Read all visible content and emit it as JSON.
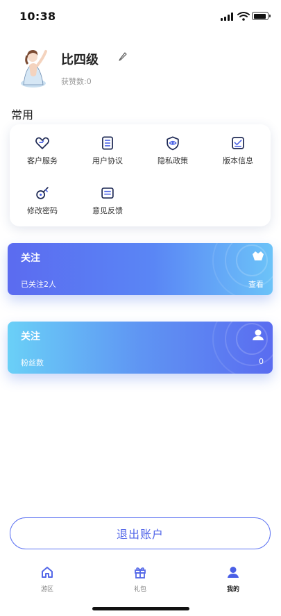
{
  "status_bar": {
    "time": "10:38"
  },
  "profile": {
    "username": "比四级",
    "likes_label": "获赞数:0"
  },
  "frequent": {
    "title": "常用",
    "items": [
      {
        "label": "客户服务",
        "icon": "heart-icon"
      },
      {
        "label": "用户协议",
        "icon": "document-list-icon"
      },
      {
        "label": "隐私政策",
        "icon": "shield-eye-icon"
      },
      {
        "label": "版本信息",
        "icon": "checklist-icon"
      },
      {
        "label": "修改密码",
        "icon": "key-icon"
      },
      {
        "label": "意见反馈",
        "icon": "feedback-icon"
      }
    ]
  },
  "follow_card": {
    "title": "关注",
    "subtitle": "已关注2人",
    "action": "查看",
    "icon": "crown-icon"
  },
  "fans_card": {
    "title": "关注",
    "subtitle": "粉丝数",
    "count": "0",
    "icon": "user-icon"
  },
  "logout_label": "退出账户",
  "tabbar": {
    "items": [
      {
        "label": "游区",
        "icon": "home-icon",
        "active": false
      },
      {
        "label": "礼包",
        "icon": "gift-icon",
        "active": false
      },
      {
        "label": "我的",
        "icon": "user-icon",
        "active": true
      }
    ]
  },
  "colors": {
    "accent": "#5a6cf0",
    "accent_light": "#6cc3f8",
    "icon_dark": "#1f2a55",
    "text_muted": "#9a9a9a"
  }
}
